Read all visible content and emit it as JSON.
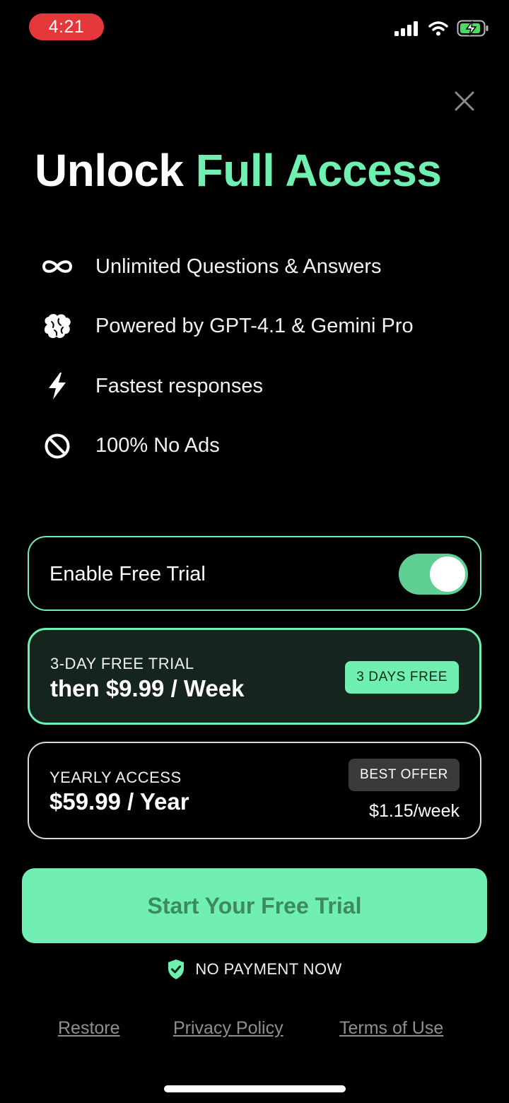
{
  "status_bar": {
    "time": "4:21"
  },
  "headline": {
    "part1": "Unlock ",
    "part2": "Full Access"
  },
  "features": [
    {
      "icon": "infinity-icon",
      "text": "Unlimited Questions & Answers"
    },
    {
      "icon": "brain-icon",
      "text": "Powered by GPT-4.1 & Gemini Pro"
    },
    {
      "icon": "lightning-icon",
      "text": "Fastest responses"
    },
    {
      "icon": "no-ads-icon",
      "text": "100% No Ads"
    }
  ],
  "free_trial_toggle": {
    "label": "Enable Free Trial",
    "enabled": true
  },
  "plans": {
    "weekly": {
      "caption": "3-DAY FREE TRIAL",
      "price": "then $9.99 / Week",
      "badge": "3 DAYS FREE",
      "selected": true
    },
    "yearly": {
      "caption": "YEARLY ACCESS",
      "price": "$59.99 / Year",
      "badge": "BEST OFFER",
      "per_week": "$1.15/week",
      "selected": false
    }
  },
  "cta": {
    "label": "Start Your Free Trial"
  },
  "no_payment": {
    "text": "NO PAYMENT NOW"
  },
  "footer": {
    "restore": "Restore",
    "privacy": "Privacy Policy",
    "terms": "Terms of Use"
  },
  "colors": {
    "accent": "#6ff0b0",
    "background": "#000000",
    "status_pill": "#e5383b"
  }
}
